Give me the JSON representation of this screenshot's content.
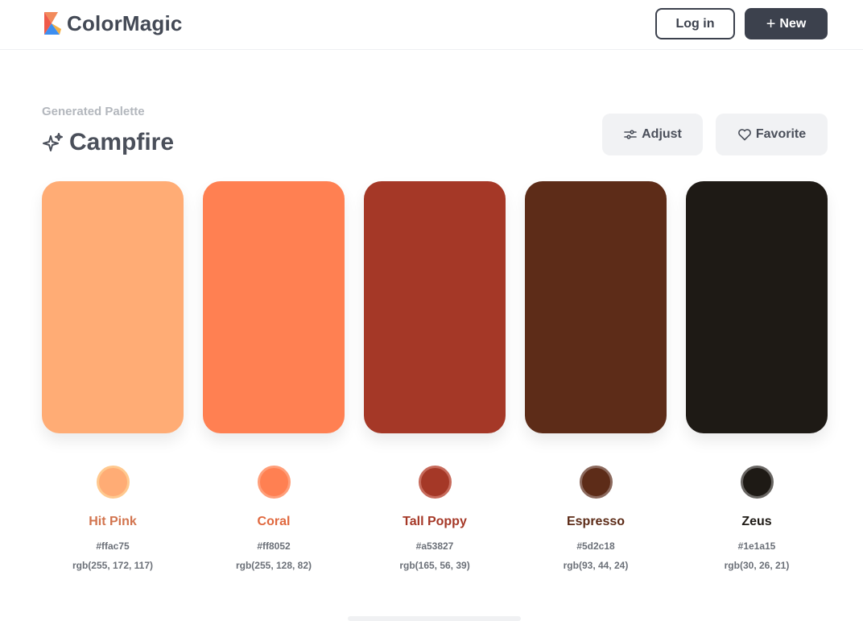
{
  "brand": {
    "name": "ColorMagic"
  },
  "header": {
    "login_label": "Log in",
    "new_label": "New"
  },
  "palette": {
    "subtitle": "Generated Palette",
    "title": "Campfire",
    "adjust_label": "Adjust",
    "favorite_label": "Favorite",
    "colors": [
      {
        "name": "Hit Pink",
        "hex": "#ffac75",
        "rgb": "rgb(255, 172, 117)",
        "label_color": "#d2744e",
        "ring_color": "#ffc98f"
      },
      {
        "name": "Coral",
        "hex": "#ff8052",
        "rgb": "rgb(255, 128, 82)",
        "label_color": "#e0683e",
        "ring_color": "#ff9f7a"
      },
      {
        "name": "Tall Poppy",
        "hex": "#a53827",
        "rgb": "rgb(165, 56, 39)",
        "label_color": "#a53827",
        "ring_color": "#c76b5c"
      },
      {
        "name": "Espresso",
        "hex": "#5d2c18",
        "rgb": "rgb(93, 44, 24)",
        "label_color": "#5d2c18",
        "ring_color": "#8c6a5e"
      },
      {
        "name": "Zeus",
        "hex": "#1e1a15",
        "rgb": "rgb(30, 26, 21)",
        "label_color": "#1e1a15",
        "ring_color": "#6a6764"
      }
    ]
  }
}
